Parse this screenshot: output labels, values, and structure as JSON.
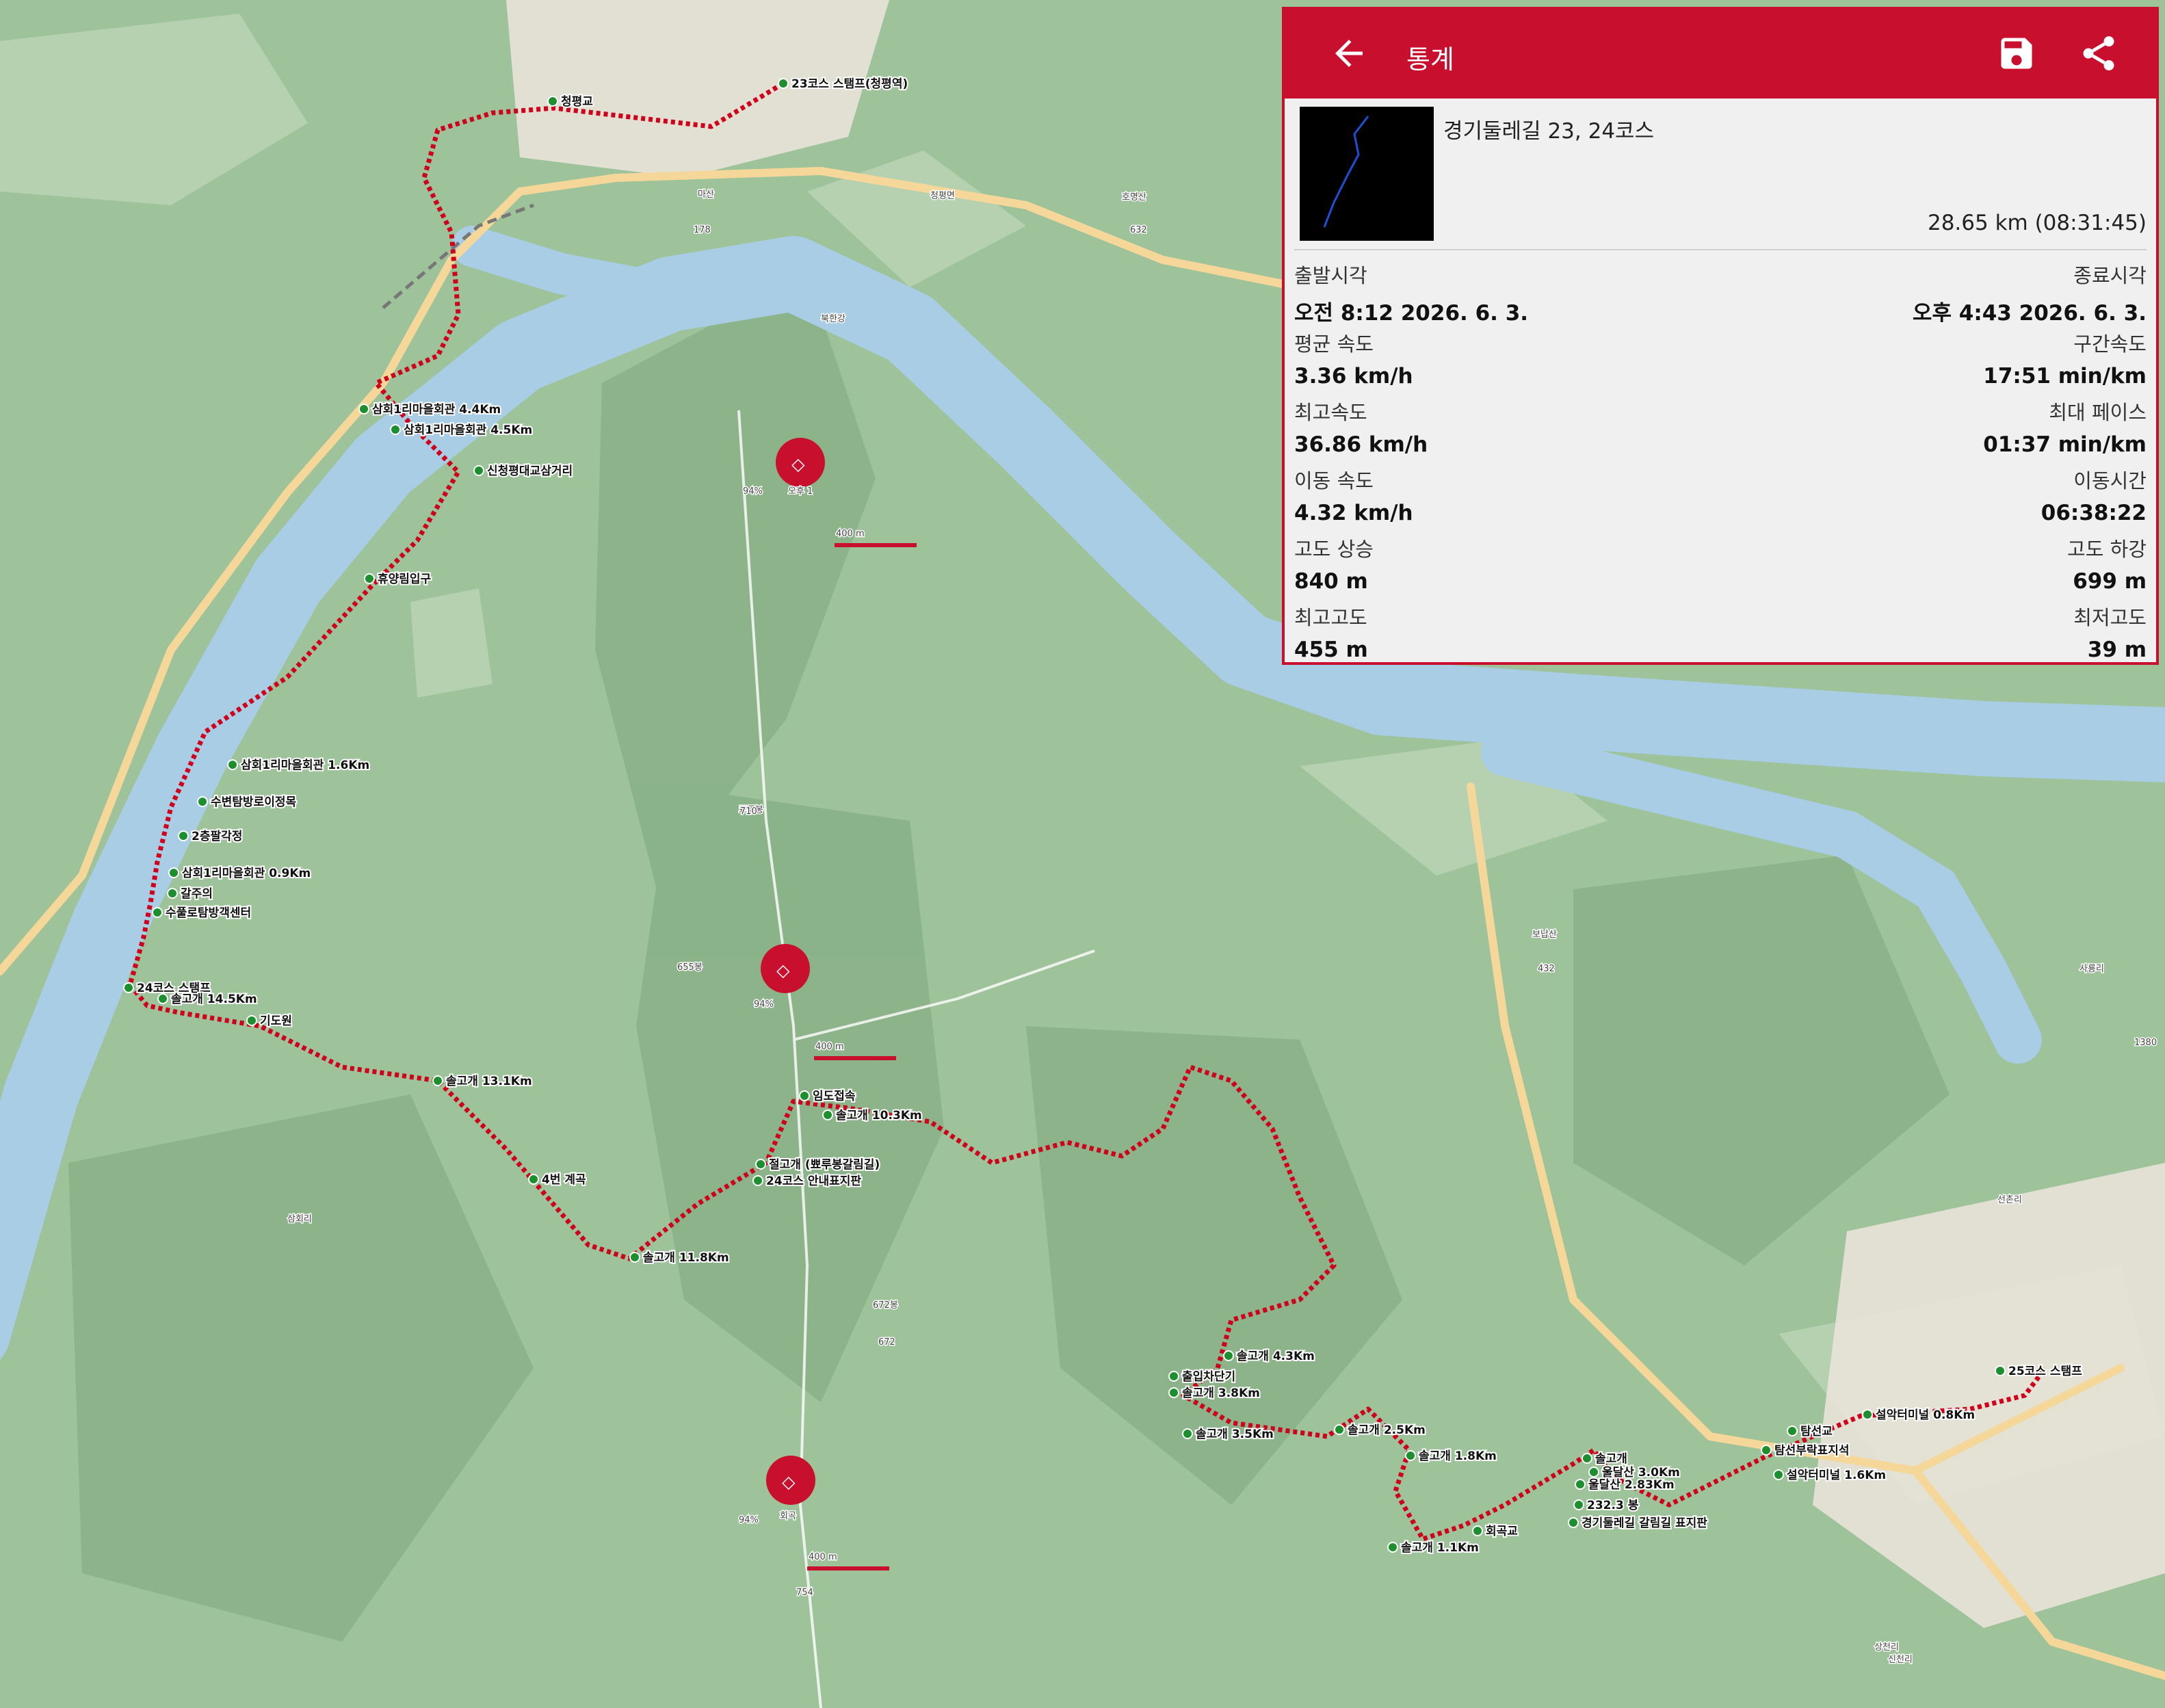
{
  "panel": {
    "title": "통계",
    "back_icon": "arrow-back-icon",
    "save_icon": "floppy-save-icon",
    "share_icon": "share-icon",
    "track_name": "경기둘레길 23, 24코스",
    "track_distance": "28.65 km (08:31:45)",
    "stats": [
      {
        "left_label": "출발시각",
        "left_value": "오전 8:12 2026. 6. 3.",
        "right_label": "종료시각",
        "right_value": "오후 4:43 2026. 6. 3."
      },
      {
        "left_label": "평균 속도",
        "left_value": "3.36 km/h",
        "right_label": "구간속도",
        "right_value": "17:51 min/km"
      },
      {
        "left_label": "최고속도",
        "left_value": "36.86 km/h",
        "right_label": "최대 페이스",
        "right_value": "01:37 min/km"
      },
      {
        "left_label": "이동 속도",
        "left_value": "4.32 km/h",
        "right_label": "이동시간",
        "right_value": "06:38:22"
      },
      {
        "left_label": "고도 상승",
        "left_value": "840 m",
        "right_label": "고도 하강",
        "right_value": "699 m"
      },
      {
        "left_label": "최고고도",
        "left_value": "455 m",
        "right_label": "최저고도",
        "right_value": "39 m"
      }
    ]
  },
  "map": {
    "colors": {
      "forest": "#9ec29a",
      "ridge": "#7fa87d",
      "water": "#a9cde4",
      "road": "#f6d79a",
      "track": "#d0021b",
      "marker": "#1e8f2e"
    },
    "scale_label": "400 m",
    "status_text": "94%",
    "time_text": "오후 1",
    "waypoints": [
      "23코스 스탬프(청평역)",
      "청평교",
      "삼회1리마을회관 4.4Km",
      "삼회1리마을회관 4.5Km",
      "신청평대교삼거리",
      "휴양림입구",
      "삼회1리마을회관 1.6Km",
      "수변탐방로이정목",
      "2층팔각정",
      "삼회1리마을회관 0.9Km",
      "갈주의",
      "수풀로탐방객센터",
      "24코스 스탬프",
      "솔고개 14.5Km",
      "기도원",
      "솔고개 13.1Km",
      "4번 계곡",
      "솔고개 11.8Km",
      "절고개 (뾰루봉갈림길)",
      "24코스 안내표지판",
      "임도접속",
      "솔고개 10.3Km",
      "솔고개 4.3Km",
      "출입차단기",
      "솔고개 3.8Km",
      "솔고개 3.5Km",
      "솔고개 2.5Km",
      "솔고개 1.8Km",
      "솔고개 1.1Km",
      "회곡교",
      "솔고개",
      "울달산 3.0Km",
      "울달산 2.83Km",
      "232.3 봉",
      "경기둘레길 갈림길 표지판",
      "탐선교",
      "탐선부락표지석",
      "설악터미널 1.6Km",
      "설악터미널 0.8Km",
      "25코스 스탬프"
    ],
    "place_labels": [
      "청평면",
      "마산",
      "호명산",
      "북한강",
      "뾰루봉",
      "672봉",
      "655봉",
      "보납산",
      "상천리",
      "선촌리",
      "신천리",
      "사룡리",
      "삼회리",
      "회곡"
    ],
    "road_numbers": [
      "178",
      "632",
      "710",
      "672",
      "754",
      "432",
      "1380"
    ]
  }
}
